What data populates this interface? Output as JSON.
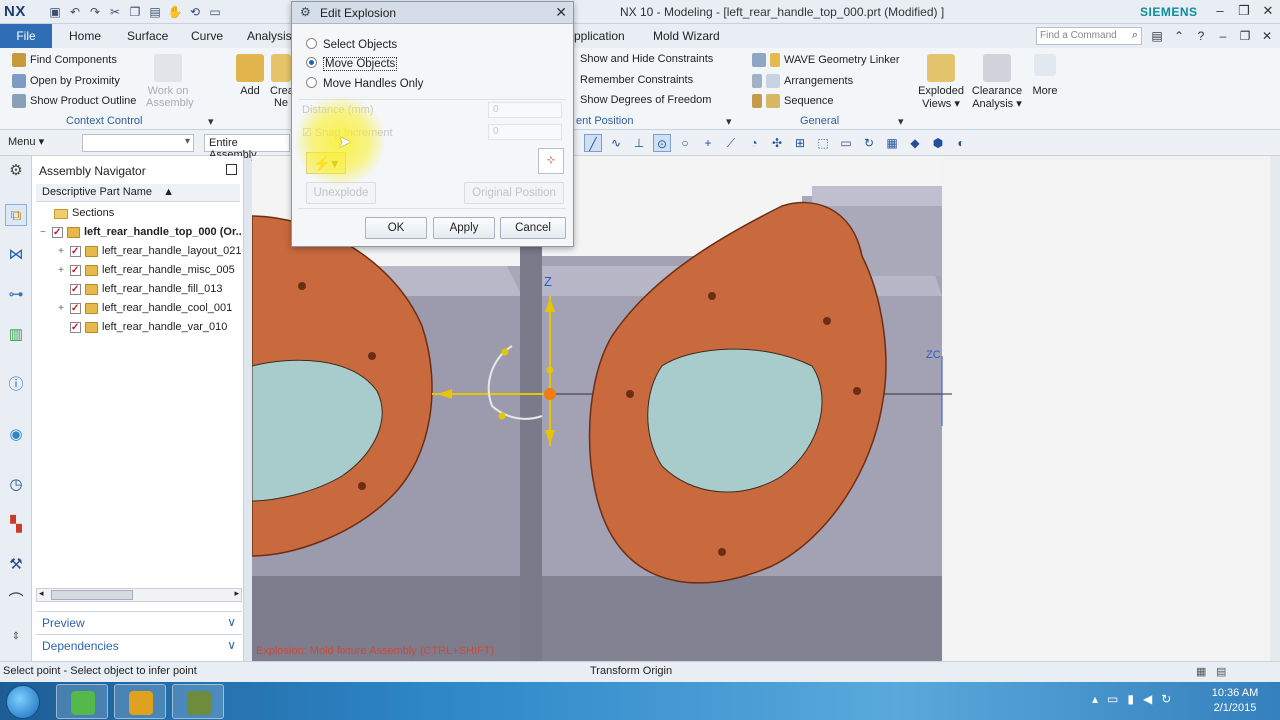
{
  "window": {
    "logo": "NX",
    "title": "NX 10 - Modeling - [left_rear_handle_top_000.prt (Modified) ]",
    "brand": "SIEMENS"
  },
  "tabs": {
    "file": "File",
    "items": [
      "Home",
      "Surface",
      "Curve",
      "Analysis",
      "pplication",
      "Mold Wizard"
    ],
    "find_command_placeholder": "Find a Command"
  },
  "ribbon": {
    "find_components": "Find Components",
    "open_by_proximity": "Open by Proximity",
    "show_product_outline": "Show Product Outline",
    "work_on_assembly_line1": "Work on",
    "work_on_assembly_line2": "Assembly",
    "add": "Add",
    "create_line1": "Crea",
    "create_line2": "Ne",
    "context_control": "Context Control",
    "show_hide_constraints": "Show and Hide Constraints",
    "remember_constraints": "Remember Constraints",
    "show_degrees_of_freedom": "Show Degrees of Freedom",
    "component_position": "ent Position",
    "wave_geometry_linker": "WAVE Geometry Linker",
    "arrangements": "Arrangements",
    "sequence": "Sequence",
    "general": "General",
    "exploded_views_line1": "Exploded",
    "exploded_views_line2": "Views ▾",
    "clearance_analysis_line1": "Clearance",
    "clearance_analysis_line2": "Analysis ▾",
    "more": "More"
  },
  "cmdbar": {
    "menu": "Menu ▾",
    "scope": "Entire Assembly"
  },
  "navigator": {
    "title": "Assembly Navigator",
    "column": "Descriptive Part Name",
    "sort_indicator": "▲",
    "sections": "Sections",
    "root": "left_rear_handle_top_000 (Or..",
    "children": [
      {
        "name": "left_rear_handle_layout_021",
        "expandable": true
      },
      {
        "name": "left_rear_handle_misc_005",
        "expandable": true
      },
      {
        "name": "left_rear_handle_fill_013",
        "expandable": false
      },
      {
        "name": "left_rear_handle_cool_001",
        "expandable": true
      },
      {
        "name": "left_rear_handle_var_010",
        "expandable": false
      }
    ],
    "preview": "Preview",
    "dependencies": "Dependencies"
  },
  "dialog": {
    "title": "Edit Explosion",
    "options": [
      "Select Objects",
      "Move Objects",
      "Move Handles Only"
    ],
    "selected_option": "Move Objects",
    "distance_label": "Distance (mm)",
    "distance_value": "0",
    "snap_label": "Snap Increment",
    "snap_value": "0",
    "unexplode": "Unexplode",
    "original_position": "Original Position",
    "ok": "OK",
    "apply": "Apply",
    "cancel": "Cancel"
  },
  "viewport": {
    "triad_z": "Z",
    "zc_label": "ZC",
    "bottom_note": "Explosion: Mold fixture Assembly (CTRL+SHIFT)"
  },
  "status": {
    "prompt": "Select point - Select object to infer point",
    "center": "Transform Origin"
  },
  "taskbar": {
    "time": "10:36 AM",
    "date": "2/1/2015"
  },
  "colors": {
    "file_tab": "#2f6eb5",
    "part_orange": "#c8683c",
    "mold_gray": "#9b9aaa",
    "highlight": "#f5eb2a"
  }
}
